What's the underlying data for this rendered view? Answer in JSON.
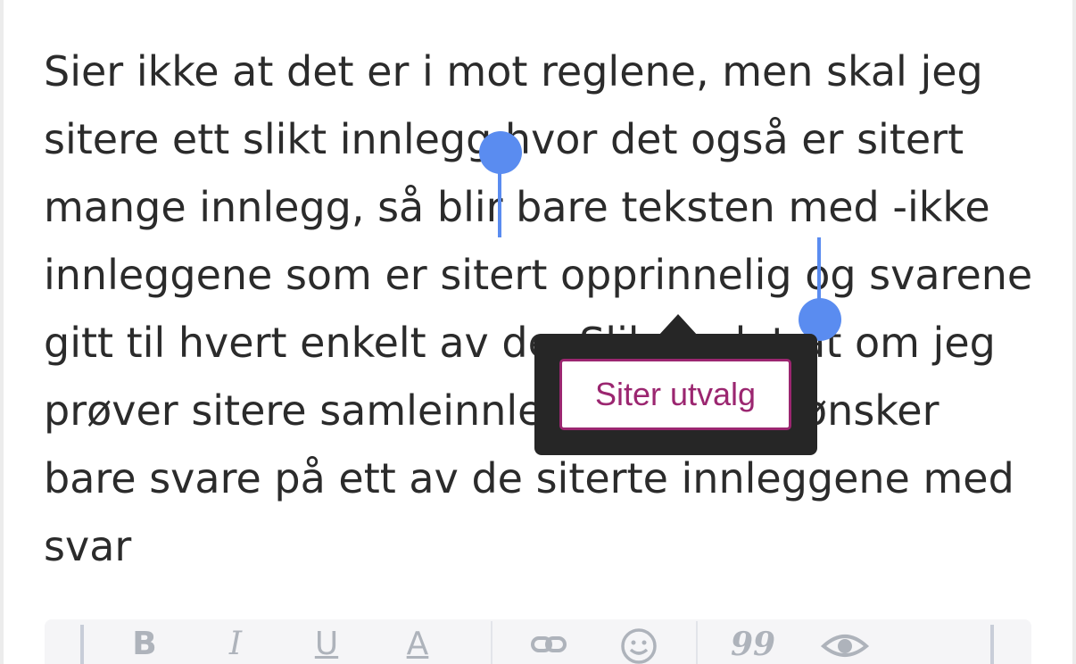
{
  "post": {
    "lines": {
      "l1": "Sier ikke at det er i mot reglene, men skal jeg",
      "l2": "sitere ett slikt innlegg hvor det også er sitert",
      "l3_before": "mange innlegg, så blir ",
      "l3_selected": "bare teksten med -ikke",
      "l4_selected": "innleggene som er sitert opprinnelig og",
      "l4_after": " svarene",
      "l5": "gitt til hvert enkelt av de. Slik er det at om jeg",
      "l6": "prøver sitere samleinnlegg, hvor jeg ønsker",
      "l7": "bare svare på ett av de siterte innleggene med",
      "l8": "svar"
    }
  },
  "selection_popover": {
    "button_label": "Siter utvalg"
  },
  "toolbar": {
    "bold": "B",
    "italic": "I",
    "underline": "U",
    "color": "A",
    "link_icon": "link-icon",
    "emoji_icon": "smiley-icon",
    "quote": "99",
    "preview_icon": "eye-icon"
  },
  "colors": {
    "text": "#2b2b2b",
    "selection": "#dbe7fb",
    "handle": "#5a8cf0",
    "popover_bg": "#262626",
    "accent": "#9b2670"
  }
}
